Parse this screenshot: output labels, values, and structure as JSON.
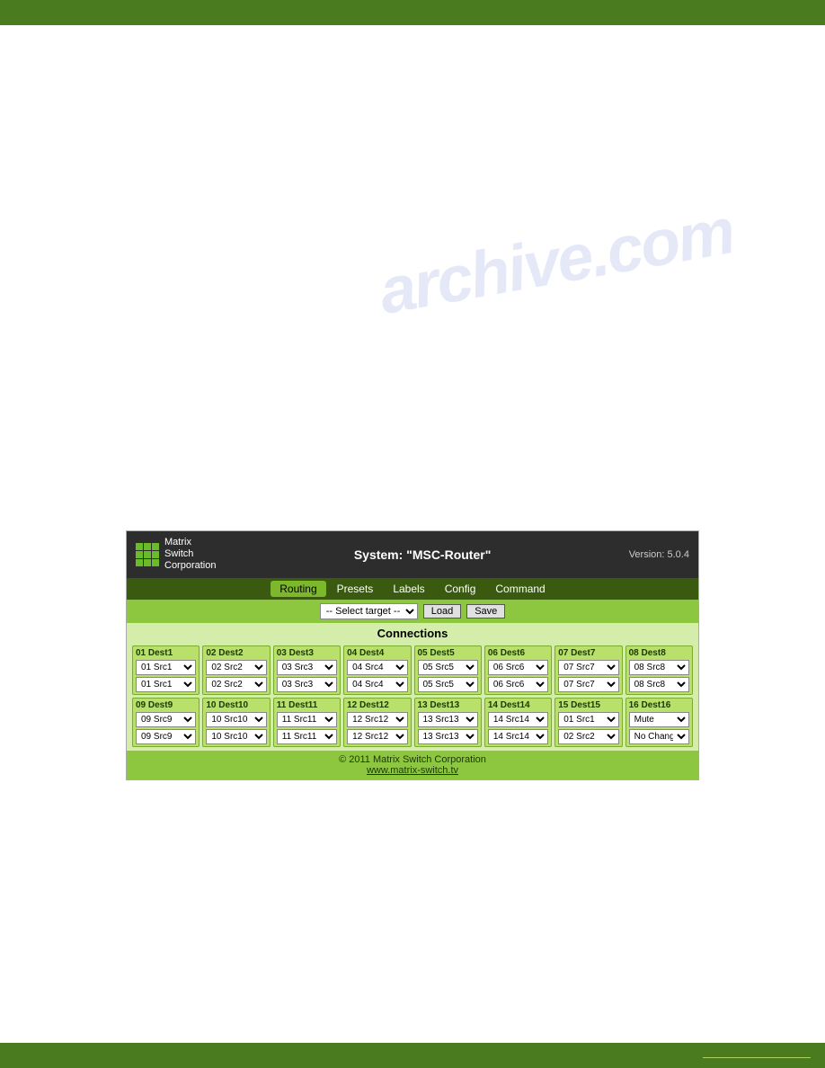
{
  "top_bar": {
    "color": "#4a7c1f"
  },
  "bottom_bar": {
    "color": "#4a7c1f"
  },
  "watermark": {
    "text": "archive.com"
  },
  "panel": {
    "header": {
      "logo_text": "Matrix\nSwitch\nCorporation",
      "system_title": "System: \"MSC-Router\"",
      "version": "Version: 5.0.4"
    },
    "nav": {
      "tabs": [
        {
          "label": "Routing",
          "active": true
        },
        {
          "label": "Presets",
          "active": false
        },
        {
          "label": "Labels",
          "active": false
        },
        {
          "label": "Config",
          "active": false
        },
        {
          "label": "Command",
          "active": false
        }
      ]
    },
    "toolbar": {
      "select_placeholder": "-- Select target --",
      "load_label": "Load",
      "save_label": "Save"
    },
    "connections_title": "Connections",
    "destinations": [
      {
        "id": "dest1",
        "label": "01 Dest1",
        "selects": [
          "01 Src1",
          "01 Src1"
        ]
      },
      {
        "id": "dest2",
        "label": "02 Dest2",
        "selects": [
          "02 Src2",
          "02 Src2"
        ]
      },
      {
        "id": "dest3",
        "label": "03 Dest3",
        "selects": [
          "03 Src3",
          "03 Src3"
        ]
      },
      {
        "id": "dest4",
        "label": "04 Dest4",
        "selects": [
          "04 Src4",
          "04 Src4"
        ]
      },
      {
        "id": "dest5",
        "label": "05 Dest5",
        "selects": [
          "05 Src5",
          "05 Src5"
        ]
      },
      {
        "id": "dest6",
        "label": "06 Dest6",
        "selects": [
          "06 Src6",
          "06 Src6"
        ]
      },
      {
        "id": "dest7",
        "label": "07 Dest7",
        "selects": [
          "07 Src7",
          "07 Src7"
        ]
      },
      {
        "id": "dest8",
        "label": "08 Dest8",
        "selects": [
          "08 Src8",
          "08 Src8"
        ]
      },
      {
        "id": "dest9",
        "label": "09 Dest9",
        "selects": [
          "09 Src9",
          "09 Src9"
        ]
      },
      {
        "id": "dest10",
        "label": "10 Dest10",
        "selects": [
          "10 Src10",
          "10 Src10"
        ]
      },
      {
        "id": "dest11",
        "label": "11 Dest11",
        "selects": [
          "11 Src11",
          "11 Src11"
        ]
      },
      {
        "id": "dest12",
        "label": "12 Dest12",
        "selects": [
          "12 Src12",
          "12 Src12"
        ]
      },
      {
        "id": "dest13",
        "label": "13 Dest13",
        "selects": [
          "13 Src13",
          "13 Src13"
        ]
      },
      {
        "id": "dest14",
        "label": "14 Dest14",
        "selects": [
          "14 Src14",
          "14 Src14"
        ]
      },
      {
        "id": "dest15",
        "label": "15 Dest15",
        "selects": [
          "01 Src1",
          "02 Src2"
        ]
      },
      {
        "id": "dest16",
        "label": "16 Dest16",
        "selects": [
          "Mute",
          "No Change"
        ]
      }
    ],
    "footer": {
      "copyright": "© 2011 Matrix Switch Corporation",
      "website": "www.matrix-switch.tv"
    }
  }
}
